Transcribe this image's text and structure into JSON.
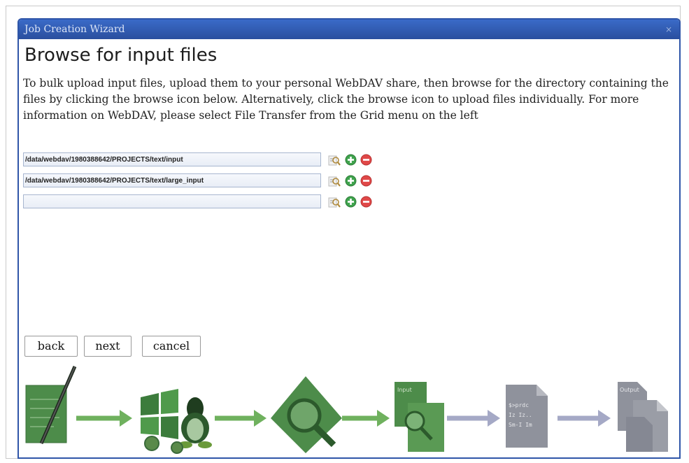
{
  "window": {
    "title": "Job Creation Wizard",
    "close_glyph": "×"
  },
  "page": {
    "heading": "Browse for input files",
    "description": "To bulk upload input files, upload them to your personal WebDAV share, then browse for the directory containing the files by clicking the browse icon below. Alternatively, click the browse icon to upload files individually. For more information on WebDAV, please select File Transfer from the Grid menu on the left"
  },
  "inputs": [
    {
      "value": "/data/webdav/1980388642/PROJECTS/text/input",
      "icons": [
        "browse-icon",
        "add-icon",
        "remove-icon"
      ]
    },
    {
      "value": "/data/webdav/1980388642/PROJECTS/text/large_input",
      "icons": [
        "browse-icon",
        "add-icon",
        "remove-icon"
      ]
    },
    {
      "value": "",
      "icons": [
        "browse-icon",
        "add-icon",
        "remove-icon"
      ]
    }
  ],
  "buttons": {
    "back": "back",
    "next": "next",
    "cancel": "cancel"
  },
  "workflow": {
    "steps": [
      "edit-document-icon",
      "platform-icon",
      "search-document-icon",
      "input-search-icon",
      "script-document-icon",
      "output-documents-icon"
    ],
    "doc_labels": {
      "input": "Input",
      "script": "$>prdc\nIz Iz..\nSm-I Im",
      "output": "Output"
    }
  },
  "colors": {
    "title_bar": "#2f55a8",
    "step_green": "#4d8c4a",
    "step_gray": "#8f929c",
    "arrow_green": "#6fb15e",
    "arrow_gray": "#a5a9c6"
  }
}
